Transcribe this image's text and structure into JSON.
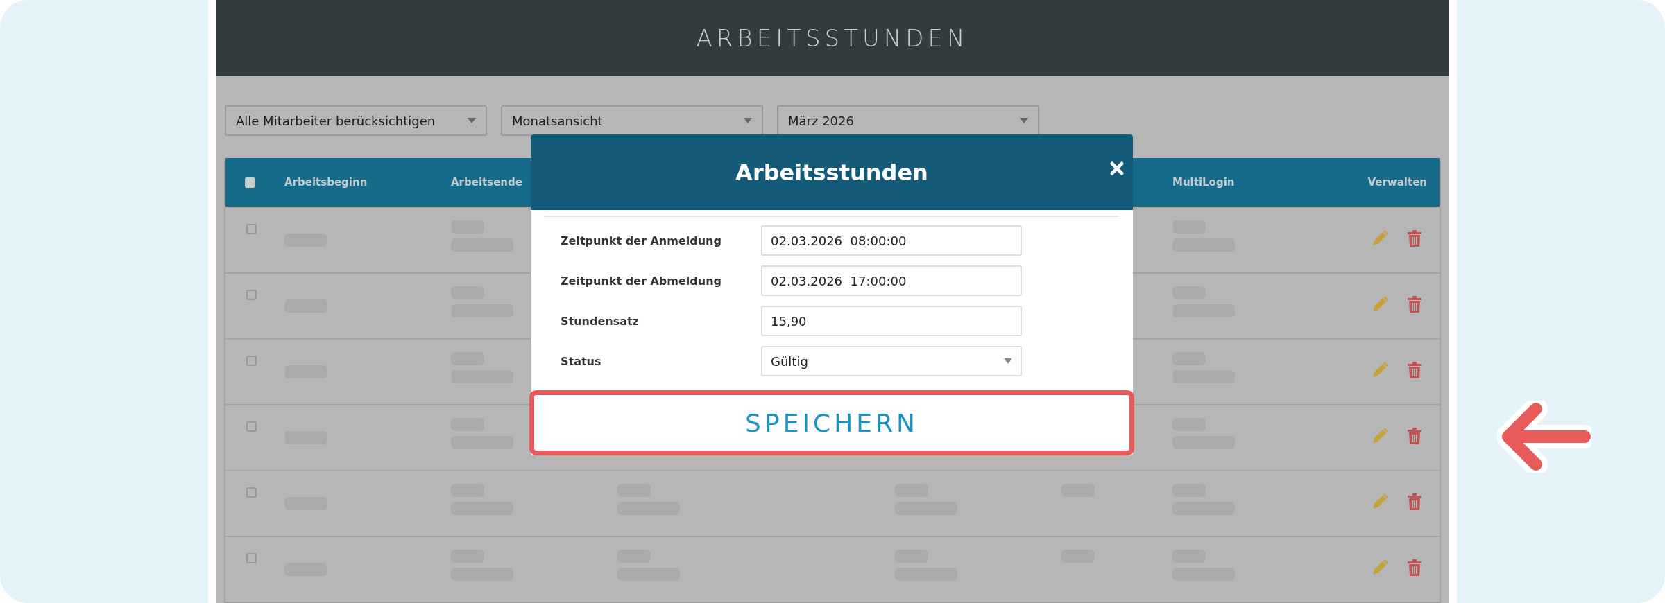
{
  "header": {
    "title": "ARBEITSSTUNDEN"
  },
  "filters": [
    {
      "value": "Alle Mitarbeiter berücksichtigen"
    },
    {
      "value": "Monatsansicht"
    },
    {
      "value": "März 2026"
    }
  ],
  "table": {
    "select_all": {
      "checked": false
    },
    "columns": [
      {
        "label": "Arbeitsbeginn"
      },
      {
        "label": "Arbeitsende"
      },
      {
        "label": "MultiLogin"
      },
      {
        "label": "Verwalten"
      }
    ],
    "rows": [
      {
        "checked": false
      },
      {
        "checked": false
      },
      {
        "checked": false
      },
      {
        "checked": false
      },
      {
        "checked": false
      },
      {
        "checked": false
      }
    ]
  },
  "modal": {
    "title": "Arbeitsstunden",
    "fields": [
      {
        "kind": "text",
        "label": "Zeitpunkt der Anmeldung",
        "value": "02.03.2026  08:00:00"
      },
      {
        "kind": "text",
        "label": "Zeitpunkt der Abmeldung",
        "value": "02.03.2026  17:00:00"
      },
      {
        "kind": "text",
        "label": "Stundensatz",
        "value": "15,90"
      },
      {
        "kind": "select",
        "label": "Status",
        "value": "Gültig"
      }
    ],
    "save_button": "SPEICHERN"
  }
}
